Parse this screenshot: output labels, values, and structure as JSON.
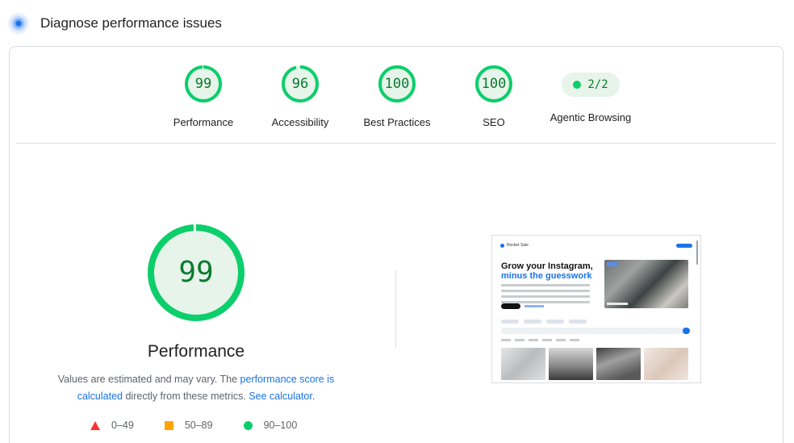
{
  "header": {
    "icon": "lighthouse-icon",
    "title": "Diagnose performance issues"
  },
  "categories": [
    {
      "score": "99",
      "label": "Performance",
      "value": 99
    },
    {
      "score": "96",
      "label": "Accessibility",
      "value": 96
    },
    {
      "score": "100",
      "label": "Best Practices",
      "value": 100
    },
    {
      "score": "100",
      "label": "SEO",
      "value": 100
    }
  ],
  "agentic": {
    "score": "2/2",
    "label": "Agentic Browsing"
  },
  "performance": {
    "score": "99",
    "value": 99,
    "title": "Performance",
    "desc_prefix": "Values are estimated and may vary. The ",
    "desc_link1": "performance score is calculated",
    "desc_middle": " directly from these metrics. ",
    "desc_link2": "See calculator."
  },
  "legend": [
    {
      "icon": "triangle-icon",
      "range": "0–49"
    },
    {
      "icon": "square-icon",
      "range": "50–89"
    },
    {
      "icon": "circle-icon",
      "range": "90–100"
    }
  ],
  "screenshot": {
    "brand": "Rocket Sale",
    "headline_line1": "Grow your Instagram,",
    "headline_line2": "minus the guesswork"
  },
  "colors": {
    "pass": "#0cce6b",
    "pass_text": "#0a7a2e",
    "average": "#ffa400",
    "fail": "#ff3333",
    "link": "#1a73e8"
  }
}
